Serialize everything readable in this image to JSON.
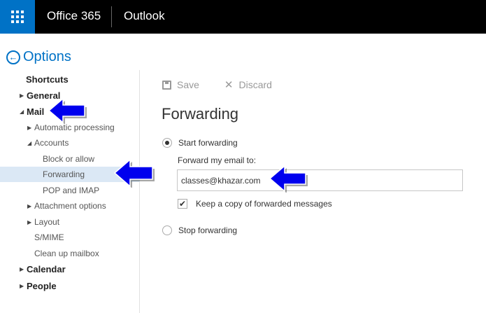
{
  "topbar": {
    "brand": "Office 365",
    "app": "Outlook"
  },
  "header": {
    "back_glyph": "←",
    "title": "Options"
  },
  "nav": {
    "shortcuts": "Shortcuts",
    "general": "General",
    "mail": "Mail",
    "automatic_processing": "Automatic processing",
    "accounts": "Accounts",
    "block_or_allow": "Block or allow",
    "forwarding": "Forwarding",
    "pop_and_imap": "POP and IMAP",
    "attachment_options": "Attachment options",
    "layout": "Layout",
    "smime": "S/MIME",
    "clean_up_mailbox": "Clean up mailbox",
    "calendar": "Calendar",
    "people": "People",
    "collapsed_glyph": "▶",
    "expanded_glyph": "◢"
  },
  "toolbar": {
    "save_label": "Save",
    "discard_label": "Discard",
    "discard_glyph": "✕"
  },
  "forwarding": {
    "title": "Forwarding",
    "start_label": "Start forwarding",
    "field_label": "Forward my email to:",
    "email_value": "classes@khazar.com",
    "keep_copy_label": "Keep a copy of forwarded messages",
    "check_glyph": "✔",
    "stop_label": "Stop forwarding",
    "start_checked": true,
    "keep_copy_checked": true
  },
  "colors": {
    "topbar": "#000000",
    "waffle": "#0072c6",
    "accent": "#0072c6",
    "selected_nav": "#dbe8f5",
    "annotation_arrow": "#0000ee"
  },
  "icons": {
    "waffle": "app-launcher-icon",
    "back": "back-arrow-icon",
    "save": "floppy-disk-icon",
    "discard": "close-icon",
    "annotation": "arrow-left-icon"
  }
}
